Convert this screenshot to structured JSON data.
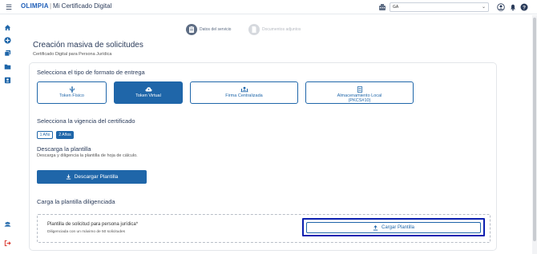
{
  "header": {
    "brand": "OLIMPIA",
    "separator": "|",
    "app_title": "Mi Certificado Digital",
    "org_select_value": "GA"
  },
  "stepper": {
    "steps": [
      {
        "label": "Datos del servicio",
        "state": "active"
      },
      {
        "label": "Documentos adjuntos",
        "state": "inactive"
      }
    ]
  },
  "page": {
    "title": "Creación masiva de solicitudes",
    "subtitle": "Certificado Digital para Persona Jurídica"
  },
  "delivery": {
    "title": "Selecciona el tipo de formato de entrega",
    "options": [
      {
        "label": "Token Físico",
        "icon": "usb-icon",
        "selected": false
      },
      {
        "label": "Token Virtual",
        "icon": "cloud-key-icon",
        "selected": true
      },
      {
        "label": "Firma Centralizada",
        "icon": "network-user-icon",
        "selected": false
      },
      {
        "label": "Almacenamiento Local",
        "label2": "(PKCS#10)",
        "icon": "document-icon",
        "selected": false
      }
    ]
  },
  "validity": {
    "title": "Selecciona la vigencia del certificado",
    "options": [
      "1 Año",
      "2 Años"
    ],
    "selected": "2 Años"
  },
  "template": {
    "title": "Descarga la plantilla",
    "description": "Descarga y diligencia la plantilla de hoja de cálculo.",
    "download_label": "Descargar Plantilla"
  },
  "upload": {
    "section_title": "Carga la plantilla diligenciada",
    "field_title": "Plantilla de solicitud para persona jurídica*",
    "field_note": "Diligenciada con un máximo de 50 solicitudes",
    "upload_label": "Cargar Plantilla"
  },
  "colors": {
    "primary": "#1f66a9",
    "title": "#2a3b5a",
    "focus_ring": "#0b1fb0",
    "logout": "#d9342b"
  }
}
